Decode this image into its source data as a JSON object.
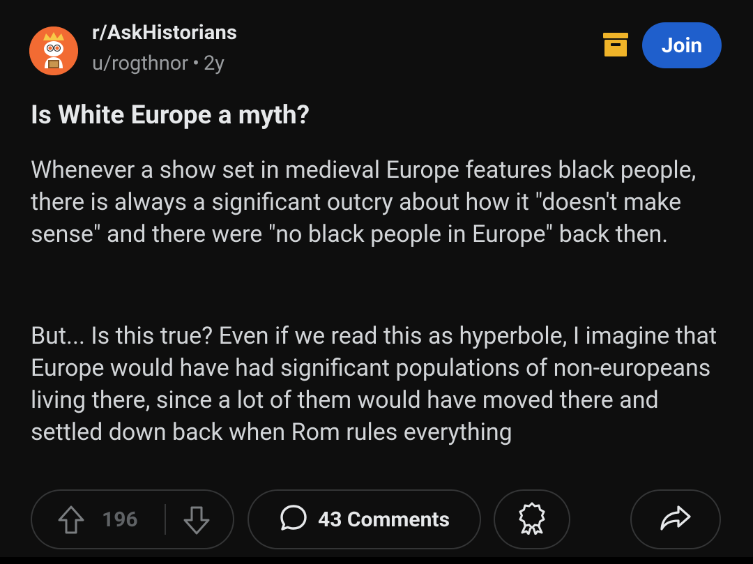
{
  "header": {
    "subreddit": "r/AskHistorians",
    "username": "u/rogthnor",
    "separator": "•",
    "age": "2y",
    "join_label": "Join",
    "accent_color": "#1f5fcc",
    "archive_icon_color": "#f0b429"
  },
  "post": {
    "title": "Is White Europe a myth?",
    "paragraph1": "Whenever a show set in medieval Europe features black people, there is always a significant outcry about how it \"doesn't make sense\" and there were \"no black people in Europe\" back then.",
    "paragraph2": "But... Is this true? Even if we read this as hyperbole, I imagine that Europe would have had significant populations of non-europeans living there, since a lot of them would have moved there and settled down back when Rom rules everything"
  },
  "actions": {
    "vote_count": "196",
    "comments_label": "43 Comments",
    "icons": [
      "upvote-icon",
      "downvote-icon",
      "comment-icon",
      "award-icon",
      "share-icon"
    ]
  }
}
